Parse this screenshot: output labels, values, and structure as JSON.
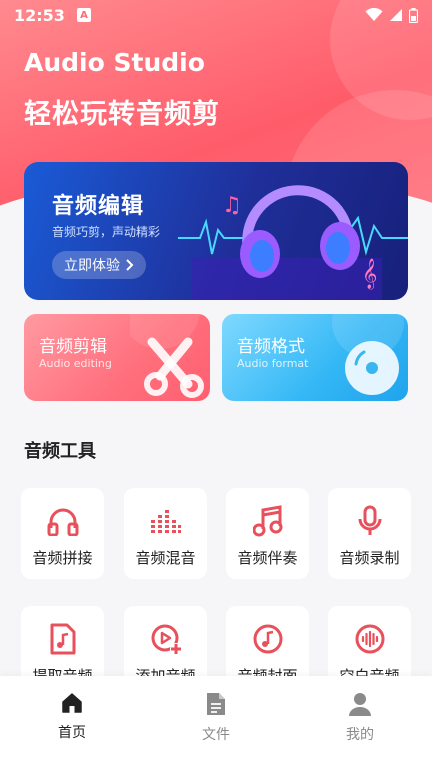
{
  "status": {
    "time": "12:53",
    "notif_letter": "A"
  },
  "header": {
    "title": "Audio Studio",
    "subtitle": "轻松玩转音频剪"
  },
  "banner": {
    "title": "音频编辑",
    "desc": "音频巧剪，声动精彩",
    "button": "立即体验"
  },
  "features": [
    {
      "title": "音频剪辑",
      "en": "Audio editing"
    },
    {
      "title": "音频格式",
      "en": "Audio format"
    }
  ],
  "tools": {
    "section_title": "音频工具",
    "items": [
      {
        "label": "音频拼接",
        "icon": "headphones-icon"
      },
      {
        "label": "音频混音",
        "icon": "equalizer-icon"
      },
      {
        "label": "音频伴奏",
        "icon": "music-note-icon"
      },
      {
        "label": "音频录制",
        "icon": "microphone-icon"
      },
      {
        "label": "提取音频",
        "icon": "file-music-icon"
      },
      {
        "label": "添加音频",
        "icon": "add-video-icon"
      },
      {
        "label": "音频封面",
        "icon": "music-disc-icon"
      },
      {
        "label": "空白音频",
        "icon": "waveform-icon"
      }
    ]
  },
  "nav": [
    {
      "label": "首页",
      "icon": "home-icon",
      "active": true
    },
    {
      "label": "文件",
      "icon": "file-icon",
      "active": false
    },
    {
      "label": "我的",
      "icon": "user-icon",
      "active": false
    }
  ],
  "colors": {
    "accent": "#e8505b",
    "banner_blue": "#1f2f9a",
    "nav_active": "#222222",
    "nav_inactive": "#8a8a8a"
  }
}
